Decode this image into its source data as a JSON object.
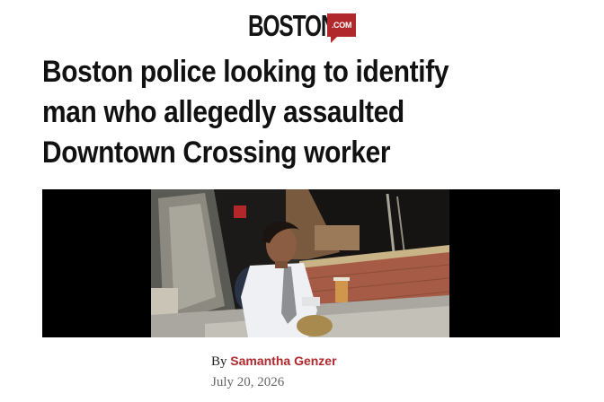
{
  "brand": {
    "wordmark": "BOSTON",
    "badge": ".COM",
    "accent_color": "#b0282c"
  },
  "article": {
    "headline_lines": [
      "Boston police looking to identify",
      "man who allegedly assaulted",
      "Downtown Crossing worker"
    ],
    "byline_prefix": "By",
    "author": "Samantha Genzer",
    "date": "July 20, 2026"
  },
  "media": {
    "kind": "surveillance-still"
  }
}
